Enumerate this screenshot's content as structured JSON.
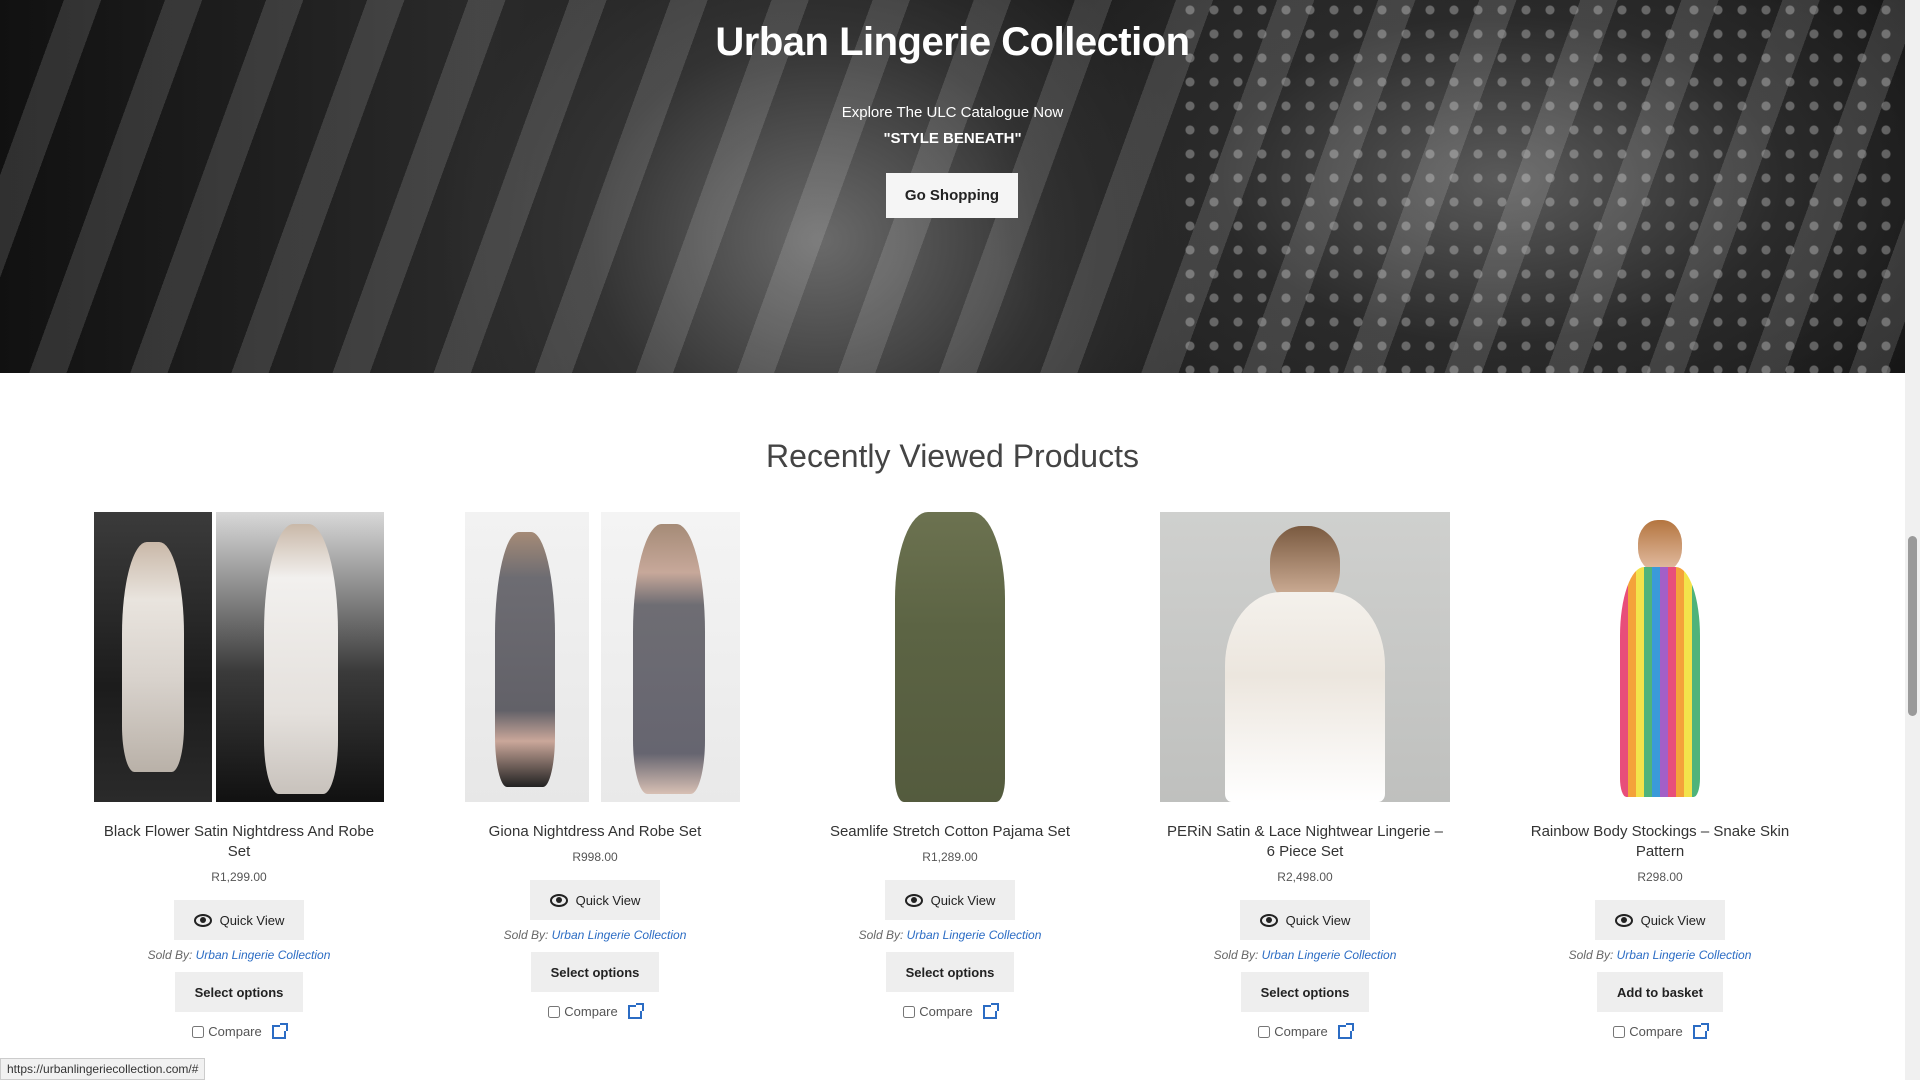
{
  "hero": {
    "title": "Urban Lingerie Collection",
    "subtitle": "Explore The ULC Catalogue Now",
    "tagline": "\"STYLE BENEATH\"",
    "button": "Go Shopping"
  },
  "section": {
    "title": "Recently Viewed Products"
  },
  "products": [
    {
      "name": "Black Flower Satin Nightdress And Robe Set",
      "price": "R1,299.00",
      "quick_view": "Quick View",
      "sold_by_label": "Sold By:",
      "seller": "Urban Lingerie Collection",
      "action": "Select options",
      "compare": "Compare"
    },
    {
      "name": "Giona Nightdress And Robe Set",
      "price": "R998.00",
      "quick_view": "Quick View",
      "sold_by_label": "Sold By:",
      "seller": "Urban Lingerie Collection",
      "action": "Select options",
      "compare": "Compare"
    },
    {
      "name": "Seamlife Stretch Cotton Pajama Set",
      "price": "R1,289.00",
      "quick_view": "Quick View",
      "sold_by_label": "Sold By:",
      "seller": "Urban Lingerie Collection",
      "action": "Select options",
      "compare": "Compare"
    },
    {
      "name": "PERiN Satin & Lace Nightwear Lingerie – 6 Piece Set",
      "price": "R2,498.00",
      "quick_view": "Quick View",
      "sold_by_label": "Sold By:",
      "seller": "Urban Lingerie Collection",
      "action": "Select options",
      "compare": "Compare"
    },
    {
      "name": "Rainbow Body Stockings – Snake Skin Pattern",
      "price": "R298.00",
      "quick_view": "Quick View",
      "sold_by_label": "Sold By:",
      "seller": "Urban Lingerie Collection",
      "action": "Add to basket",
      "compare": "Compare"
    }
  ],
  "status_bar": {
    "url": "https://urbanlingeriecollection.com/#"
  },
  "colors": {
    "link": "#2b6cc4",
    "button_bg": "#eeeeee",
    "hero_bg": "#1e1e1e"
  }
}
